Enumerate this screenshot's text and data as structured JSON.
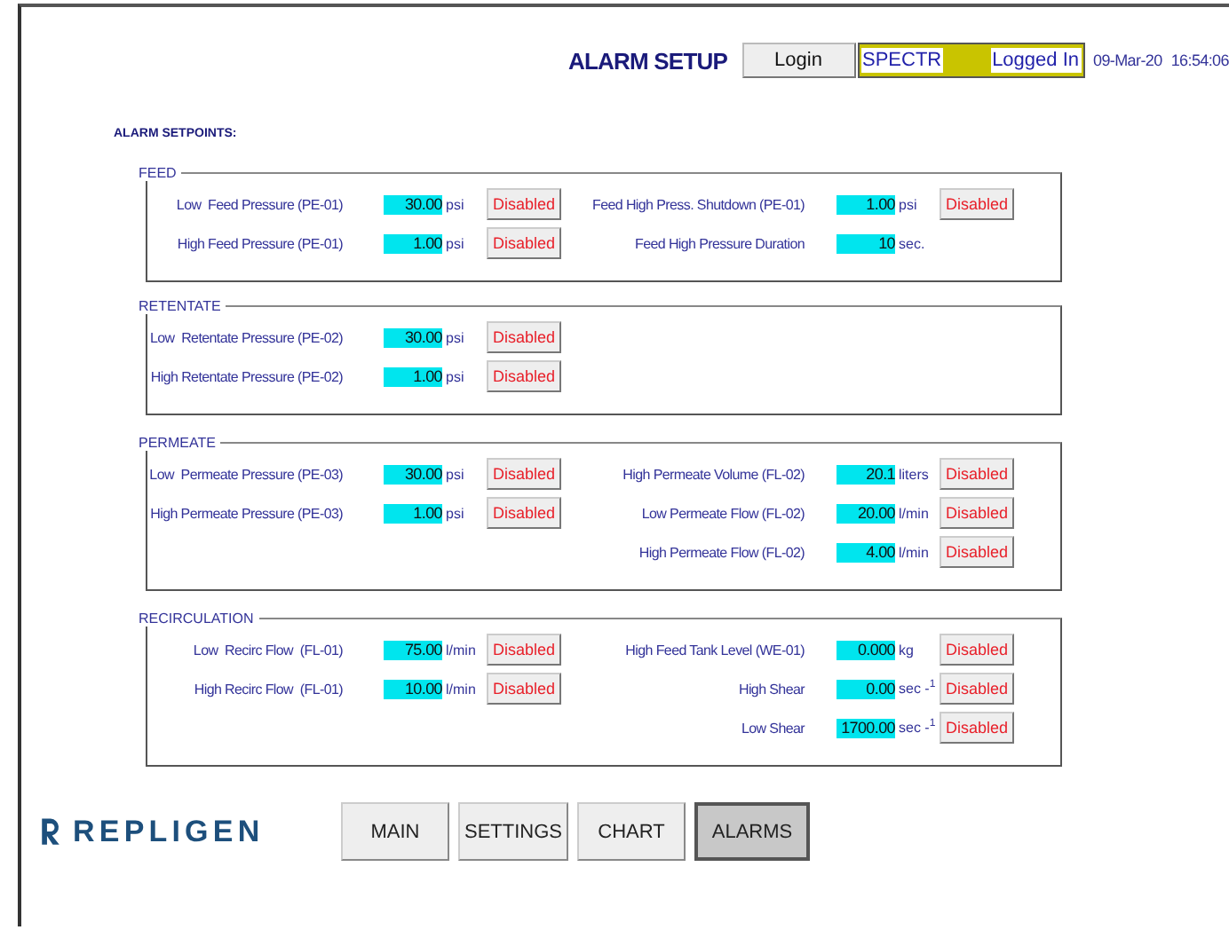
{
  "header": {
    "title": "ALARM SETUP",
    "login_button": "Login",
    "user": "SPECTR",
    "login_status": "Logged In",
    "date": "09-Mar-20",
    "time": "16:54:06"
  },
  "subtitle": "ALARM SETPOINTS:",
  "sections": [
    {
      "title": "FEED",
      "left": [
        {
          "label": "Low  Feed Pressure (PE-01)",
          "value": "30.00",
          "unit": "psi",
          "button": "Disabled"
        },
        {
          "label": "High Feed Pressure (PE-01)",
          "value": "1.00",
          "unit": "psi",
          "button": "Disabled"
        }
      ],
      "right": [
        {
          "label": "Feed High Press. Shutdown (PE-01)",
          "value": "1.00",
          "unit": "psi",
          "button": "Disabled"
        },
        {
          "label": "Feed High Pressure Duration",
          "value": "10",
          "unit": "sec."
        }
      ]
    },
    {
      "title": "RETENTATE",
      "left": [
        {
          "label": "Low  Retentate Pressure (PE-02)",
          "value": "30.00",
          "unit": "psi",
          "button": "Disabled"
        },
        {
          "label": "High Retentate Pressure (PE-02)",
          "value": "1.00",
          "unit": "psi",
          "button": "Disabled"
        }
      ]
    },
    {
      "title": "PERMEATE",
      "left": [
        {
          "label": "Low  Permeate Pressure (PE-03)",
          "value": "30.00",
          "unit": "psi",
          "button": "Disabled"
        },
        {
          "label": "High Permeate Pressure (PE-03)",
          "value": "1.00",
          "unit": "psi",
          "button": "Disabled"
        }
      ],
      "right": [
        {
          "label": "High Permeate Volume (FL-02)",
          "value": "20.1",
          "unit": "liters",
          "button": "Disabled"
        },
        {
          "label": "Low Permeate Flow (FL-02)",
          "value": "20.00",
          "unit": "l/min",
          "button": "Disabled"
        },
        {
          "label": "High Permeate Flow (FL-02)",
          "value": "4.00",
          "unit": "l/min",
          "button": "Disabled"
        }
      ]
    },
    {
      "title": "RECIRCULATION",
      "left": [
        {
          "label": "Low  Recirc Flow  (FL-01)",
          "value": "75.00",
          "unit": "l/min",
          "button": "Disabled"
        },
        {
          "label": "High Recirc Flow  (FL-01)",
          "value": "10.00",
          "unit": "l/min",
          "button": "Disabled"
        }
      ],
      "right": [
        {
          "label": "High Feed Tank Level (WE-01)",
          "value": "0.000",
          "unit": "kg",
          "button": "Disabled"
        },
        {
          "label": "High Shear",
          "value": "0.00",
          "unit": "sec -$^{1}$",
          "button": "Disabled"
        },
        {
          "label": "Low Shear",
          "value": "1700.00",
          "unit": "sec -$^{1}$",
          "button": "Disabled"
        }
      ]
    }
  ],
  "logo": "REPLIGEN",
  "nav": [
    {
      "label": "MAIN",
      "selected": false
    },
    {
      "label": "SETTINGS",
      "selected": false
    },
    {
      "label": "CHART",
      "selected": false
    },
    {
      "label": "ALARMS",
      "selected": true
    }
  ]
}
